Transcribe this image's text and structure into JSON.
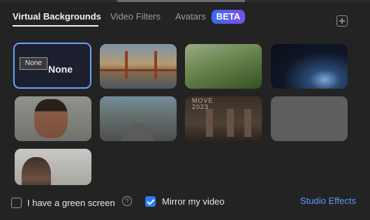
{
  "tabs": [
    {
      "label": "Virtual Backgrounds",
      "active": true
    },
    {
      "label": "Video Filters",
      "active": false
    },
    {
      "label": "Avatars",
      "active": false
    }
  ],
  "beta_badge": "BETA",
  "backgrounds": {
    "selected_label": "None",
    "tooltip": "None",
    "items": [
      {
        "name": "none",
        "selected": true
      },
      {
        "name": "golden-gate-bridge"
      },
      {
        "name": "grass"
      },
      {
        "name": "earth-from-space"
      },
      {
        "name": "face-image"
      },
      {
        "name": "city-street"
      },
      {
        "name": "move-2023",
        "text": "MOVE\n2023"
      },
      {
        "name": "blank"
      },
      {
        "name": "person-video"
      }
    ]
  },
  "options": {
    "green_screen": {
      "label": "I have a green screen",
      "checked": false,
      "help_icon": "?"
    },
    "mirror_video": {
      "label": "Mirror my video",
      "checked": true
    }
  },
  "studio_effects": "Studio Effects",
  "colors": {
    "accent": "#2d7cf6",
    "selected_border": "#6aa2ff",
    "link": "#5a9cff",
    "background": "#232323"
  }
}
